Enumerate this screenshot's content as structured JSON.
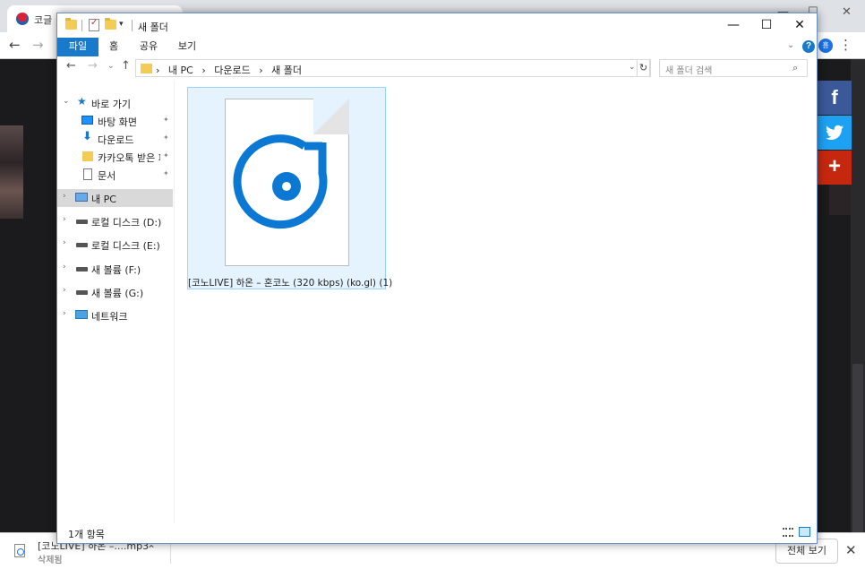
{
  "browser": {
    "tab_title": "코글",
    "minimize": "—",
    "maximize": "☐",
    "close": "✕",
    "back": "←",
    "forward": "→",
    "menu": "⋮",
    "avatar_text": "흥"
  },
  "share": {
    "facebook": "f",
    "plus": "+"
  },
  "download_bar": {
    "file_name": "[코노LIVE] 하온 –....mp3",
    "status": "삭제됨",
    "chevron": "⌃",
    "show_all": "전체 보기",
    "close": "✕"
  },
  "explorer": {
    "title": "새 폴더",
    "window_controls": {
      "minimize": "—",
      "maximize": "☐",
      "close": "✕"
    },
    "ribbon": {
      "tabs": [
        "파일",
        "홈",
        "공유",
        "보기"
      ],
      "active_tab": "파일",
      "expand_chevron": "⌄",
      "help": "?"
    },
    "address": {
      "back": "←",
      "forward": "→",
      "recent": "⌄",
      "up": "↑",
      "crumbs": [
        "›",
        "내 PC",
        "›",
        "다운로드",
        "›",
        "새 폴더"
      ],
      "dropdown": "⌄",
      "refresh": "↻"
    },
    "search": {
      "placeholder": "새 폴더 검색",
      "icon": "⌕"
    },
    "nav_pane": {
      "quick_access": "바로 가기",
      "pinned": [
        {
          "label": "바탕 화면",
          "icon": "desktop-icon"
        },
        {
          "label": "다운로드",
          "icon": "download-icon"
        },
        {
          "label": "카카오톡 받은 파",
          "icon": "folder-icon"
        },
        {
          "label": "문서",
          "icon": "document-icon"
        }
      ],
      "pin_glyph": "📌",
      "this_pc": "내 PC",
      "drives": [
        "로컬 디스크 (D:)",
        "로컬 디스크 (E:)",
        "새 볼륨 (F:)",
        "새 볼륨 (G:)"
      ],
      "network": "네트워크",
      "expand_glyph": "›",
      "collapse_glyph": "⌄"
    },
    "files": [
      {
        "name": "[코노LIVE] 하온 – 혼코노 (320  kbps) (ko.gl) (1)",
        "icon": "groove-music-file-icon",
        "accent": "#0b78d4"
      }
    ],
    "status": {
      "item_count": "1개 항목"
    }
  },
  "colors": {
    "accent": "#1979ca",
    "file_selected_bg": "#e5f3ff",
    "file_selected_border": "#99d1ff",
    "facebook": "#3b5998",
    "twitter": "#1da1f2",
    "plus": "#c6280f"
  }
}
